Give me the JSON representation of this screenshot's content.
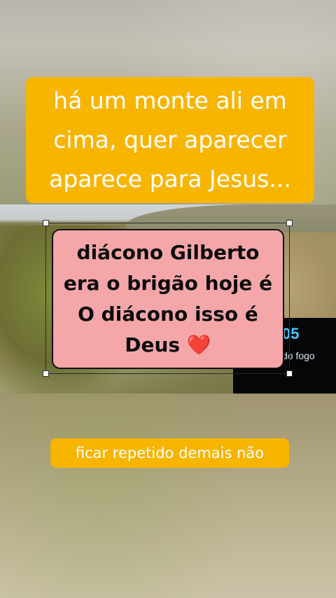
{
  "captions": {
    "top": "há um monte ali em cima, quer aparecer aparece para Jesus...",
    "pink_text": "diácono Gilberto era o brigão hoje é O diácono isso é Deus",
    "pink_emoji": "❤️",
    "bottom": "ficar repetido demais não"
  },
  "video": {
    "overlay_number": "05",
    "overlay_text": "do fogo"
  },
  "colors": {
    "caption_yellow": "#f7b500",
    "caption_pink": "#f5a6a9",
    "overlay_blue": "#4ec6ff"
  },
  "icons": {
    "heart": "red-heart-emoji"
  }
}
